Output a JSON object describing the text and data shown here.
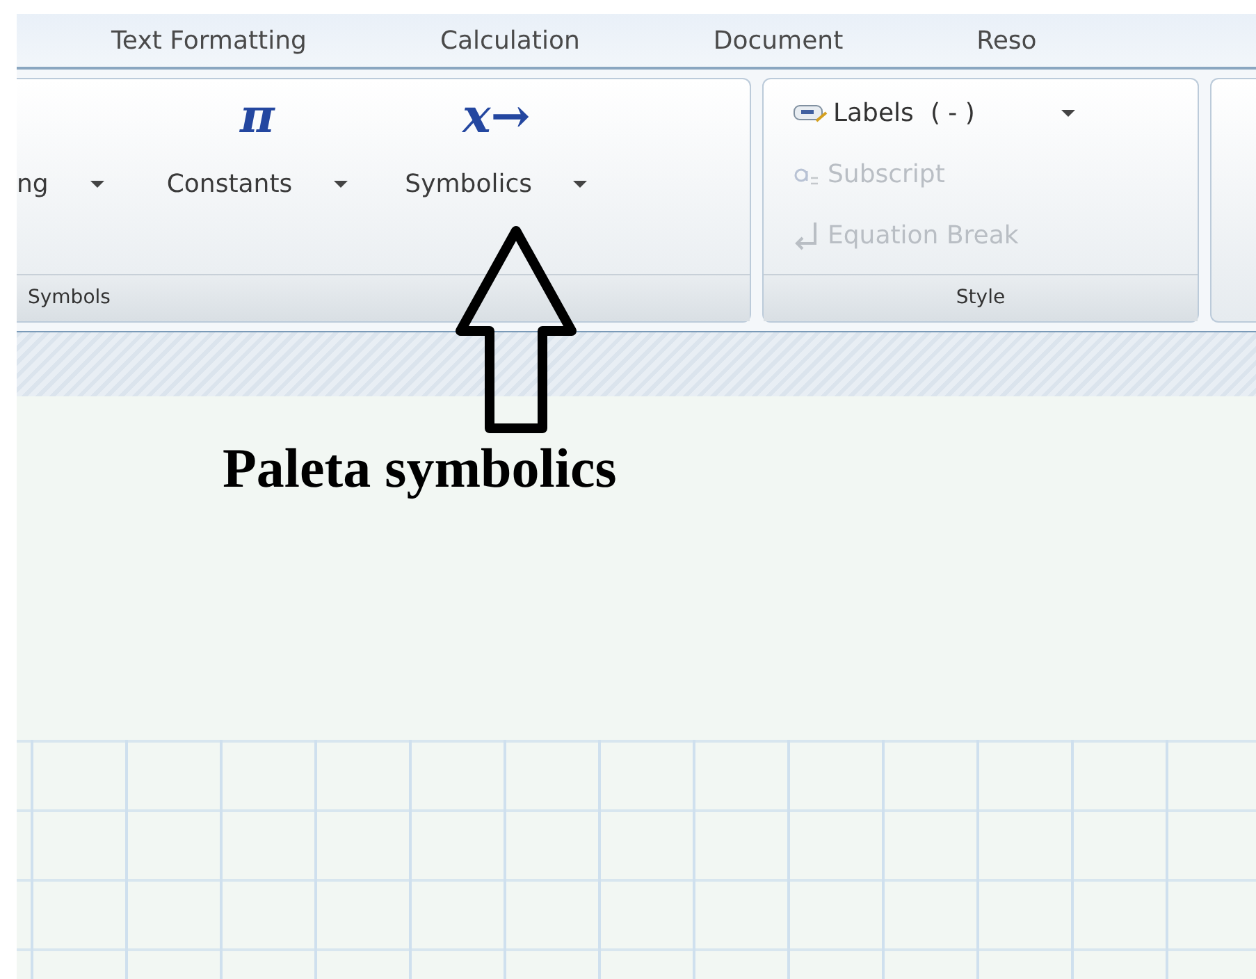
{
  "tabs": [
    {
      "label": "Text Formatting"
    },
    {
      "label": "Calculation"
    },
    {
      "label": "Document"
    },
    {
      "label": "Reso"
    }
  ],
  "ribbon_groups": [
    {
      "title": "Symbols",
      "kind": "large",
      "buttons": [
        {
          "label": "ng"
        },
        {
          "label": "Constants",
          "glyph": "π"
        },
        {
          "label": "Symbolics",
          "glyph": "x→"
        }
      ]
    },
    {
      "title": "Style",
      "kind": "small",
      "buttons": [
        {
          "label": "Labels",
          "value": "( - )",
          "kind": "dropdown",
          "disabled": false
        },
        {
          "label": "Subscript",
          "kind": "subscript",
          "disabled": true
        },
        {
          "label": "Equation Break",
          "kind": "break",
          "disabled": true
        }
      ]
    },
    {
      "kind": "empty"
    }
  ],
  "annotation": {
    "text": "Paleta symbolics"
  }
}
